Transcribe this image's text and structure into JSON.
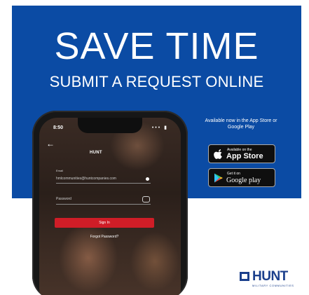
{
  "headline": "SAVE TIME",
  "subheadline": "SUBMIT A REQUEST ONLINE",
  "phone": {
    "status_time": "8:50",
    "status_icons": "••• ▮",
    "back_icon": "←",
    "app_logo": "HUNT",
    "email_label": "Email",
    "email_value": "hmlcommunities@huntcompanies.com",
    "password_placeholder": "Password",
    "sign_in_label": "Sign In",
    "forgot_password_label": "Forgot Password?"
  },
  "availability_text": "Available now in the App Store or Google Play",
  "app_store_badge": {
    "small_text": "Available on the",
    "big_text": "App Store"
  },
  "google_play_badge": {
    "small_text": "Get it on",
    "big_text": "Google play"
  },
  "brand": {
    "wordmark": "HUNT",
    "tagline": "MILITARY COMMUNITIES"
  },
  "colors": {
    "blue": "#0b4ba4",
    "sign_in_red": "#d01d27",
    "logo_blue": "#1b3f8c"
  }
}
